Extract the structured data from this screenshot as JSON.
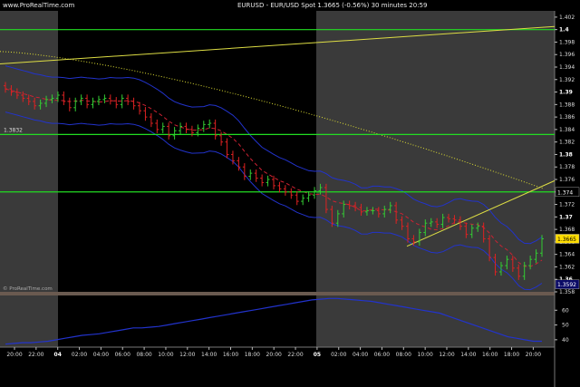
{
  "header": {
    "brand": "www.ProRealTime.com",
    "title": "EURUSD - EUR/USD Spot   1.3665 (-0.56%)   30 minutes  20:59"
  },
  "watermark": "© ProRealTime.com",
  "colors": {
    "support_lines": "#22dd22",
    "candle_up": "#33cc33",
    "candle_down": "#dd2222",
    "bollinger": "#2233cc",
    "moving_average": "#dddd33",
    "trendline": "#dddd44",
    "regression": "#cc2233",
    "session_shade": "#3a3a3a"
  },
  "price_axis": {
    "ticks": [
      "1.402",
      "1.4",
      "1.398",
      "1.396",
      "1.394",
      "1.392",
      "1.39",
      "1.388",
      "1.386",
      "1.384",
      "1.382",
      "1.38",
      "1.378",
      "1.376",
      "1.374",
      "1.372",
      "1.37",
      "1.368",
      "1.366",
      "1.364",
      "1.362",
      "1.36",
      "1.358"
    ],
    "bold_ticks": [
      "1.4",
      "1.39",
      "1.38",
      "1.37",
      "1.36"
    ],
    "current_price_label": "1.3665",
    "level_label": "1.374",
    "low_label": "1.3592",
    "left_level_label": "1.3832"
  },
  "indicator_axis": {
    "ticks": [
      "60",
      "50",
      "40"
    ]
  },
  "time_axis": {
    "labels": [
      "20:00",
      "22:00",
      "04",
      "02:00",
      "04:00",
      "06:00",
      "08:00",
      "10:00",
      "12:00",
      "14:00",
      "16:00",
      "18:00",
      "20:00",
      "22:00",
      "05",
      "02:00",
      "04:00",
      "06:00",
      "08:00",
      "10:00",
      "12:00",
      "14:00",
      "16:00",
      "18:00",
      "20:00"
    ],
    "bold_labels": [
      "04",
      "05"
    ]
  },
  "chart_data": {
    "type": "candlestick",
    "instrument": "EURUSD - EUR/USD Spot",
    "timeframe": "30 minutes",
    "last_price": 1.3665,
    "change_percent": -0.56,
    "horizontal_levels": [
      1.4,
      1.3832,
      1.374
    ],
    "price_range": [
      1.358,
      1.403
    ],
    "closes": [
      1.3905,
      1.39,
      1.3895,
      1.389,
      1.3885,
      1.3878,
      1.3882,
      1.3888,
      1.389,
      1.3895,
      1.3885,
      1.3875,
      1.3885,
      1.389,
      1.388,
      1.3885,
      1.3888,
      1.389,
      1.3886,
      1.388,
      1.389,
      1.3885,
      1.3878,
      1.387,
      1.386,
      1.385,
      1.384,
      1.3845,
      1.383,
      1.3838,
      1.3845,
      1.384,
      1.3835,
      1.3842,
      1.3848,
      1.385,
      1.383,
      1.382,
      1.38,
      1.379,
      1.378,
      1.3765,
      1.377,
      1.3762,
      1.3755,
      1.376,
      1.375,
      1.3745,
      1.374,
      1.3735,
      1.3725,
      1.373,
      1.3735,
      1.3742,
      1.3747,
      1.3712,
      1.369,
      1.3705,
      1.372,
      1.3718,
      1.3715,
      1.3708,
      1.371,
      1.371,
      1.3705,
      1.3712,
      1.3718,
      1.3695,
      1.3685,
      1.3665,
      1.366,
      1.3675,
      1.369,
      1.3692,
      1.3688,
      1.3699,
      1.3697,
      1.3695,
      1.3685,
      1.3672,
      1.3682,
      1.3685,
      1.3665,
      1.3635,
      1.3612,
      1.3622,
      1.3632,
      1.3618,
      1.3605,
      1.3622,
      1.3632,
      1.3642,
      1.3665
    ]
  },
  "indicator": {
    "axis_range": [
      35,
      70
    ],
    "values": [
      37,
      37.5,
      38,
      38,
      38.5,
      39,
      40,
      41,
      42,
      43,
      43.5,
      44,
      45,
      46,
      47,
      48,
      48,
      48.5,
      49,
      50,
      51,
      52,
      53,
      54,
      55,
      56,
      57,
      58,
      59,
      60,
      61,
      62,
      63,
      64,
      65,
      66,
      67,
      67.5,
      68,
      68,
      67.5,
      67,
      66.5,
      66,
      65,
      64,
      63,
      62,
      61,
      60,
      59,
      58,
      56,
      54,
      52,
      50,
      48,
      46,
      44,
      42,
      41,
      40,
      39,
      39
    ]
  }
}
